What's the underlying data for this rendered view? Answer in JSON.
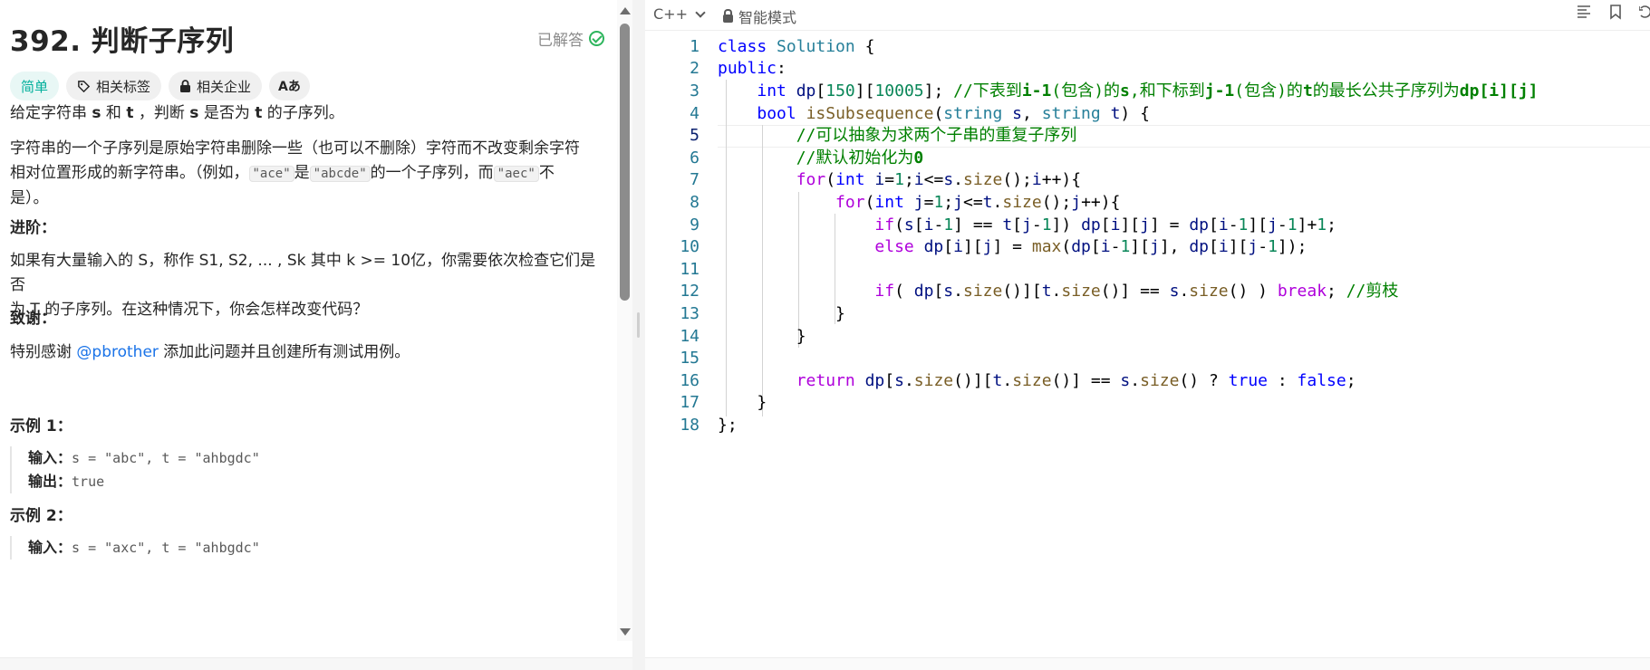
{
  "problem": {
    "title": "392. 判断子序列",
    "status": "已解答",
    "tags": {
      "difficulty": "简单",
      "topics": "相关标签",
      "companies": "相关企业",
      "translate": "Aあ"
    },
    "desc1_pre": "给定字符串 ",
    "desc1_s": "s",
    "desc1_mid": " 和 ",
    "desc1_t": "t",
    "desc1_mid2": " ，判断 ",
    "desc1_s2": "s",
    "desc1_mid3": " 是否为 ",
    "desc1_t2": "t",
    "desc1_end": " 的子序列。",
    "desc2_a": "字符串的一个子序列是原始字符串删除一些（也可以不删除）字符而不改变剩余字符",
    "desc2_b": "相对位置形成的新字符串。（例如，",
    "desc2_code1": "\"ace\"",
    "desc2_c": "是",
    "desc2_code2": "\"abcde\"",
    "desc2_d": "的一个子序列，而",
    "desc2_code3": "\"aec\"",
    "desc2_e": "不",
    "desc2_f": "是）。",
    "advanced_heading": "进阶：",
    "advanced_a": "如果有大量输入的 S，称作 S1, S2, ... , Sk 其中 k >= 10亿，你需要依次检查它们是否",
    "advanced_b": "为 T 的子序列。在这种情况下，你会怎样改变代码？",
    "thanks_heading": "致谢：",
    "thanks_pre": "特别感谢 ",
    "thanks_link": "@pbrother",
    "thanks_post": " 添加此问题并且创建所有测试用例。",
    "example1_heading": "示例 1：",
    "example1_input_label": "输入：",
    "example1_input": "s = \"abc\", t = \"ahbgdc\"",
    "example1_output_label": "输出：",
    "example1_output": "true",
    "example2_heading": "示例 2：",
    "example2_input_label": "输入：",
    "example2_input": "s = \"axc\", t = \"ahbgdc\""
  },
  "editor": {
    "language": "C++",
    "mode": "智能模式",
    "line_numbers": [
      "1",
      "2",
      "3",
      "4",
      "5",
      "6",
      "7",
      "8",
      "9",
      "10",
      "11",
      "12",
      "13",
      "14",
      "15",
      "16",
      "17",
      "18"
    ]
  },
  "colors": {
    "accent_easy": "#00af9b",
    "solved_green": "#2db55d",
    "link": "#1a73e8"
  }
}
